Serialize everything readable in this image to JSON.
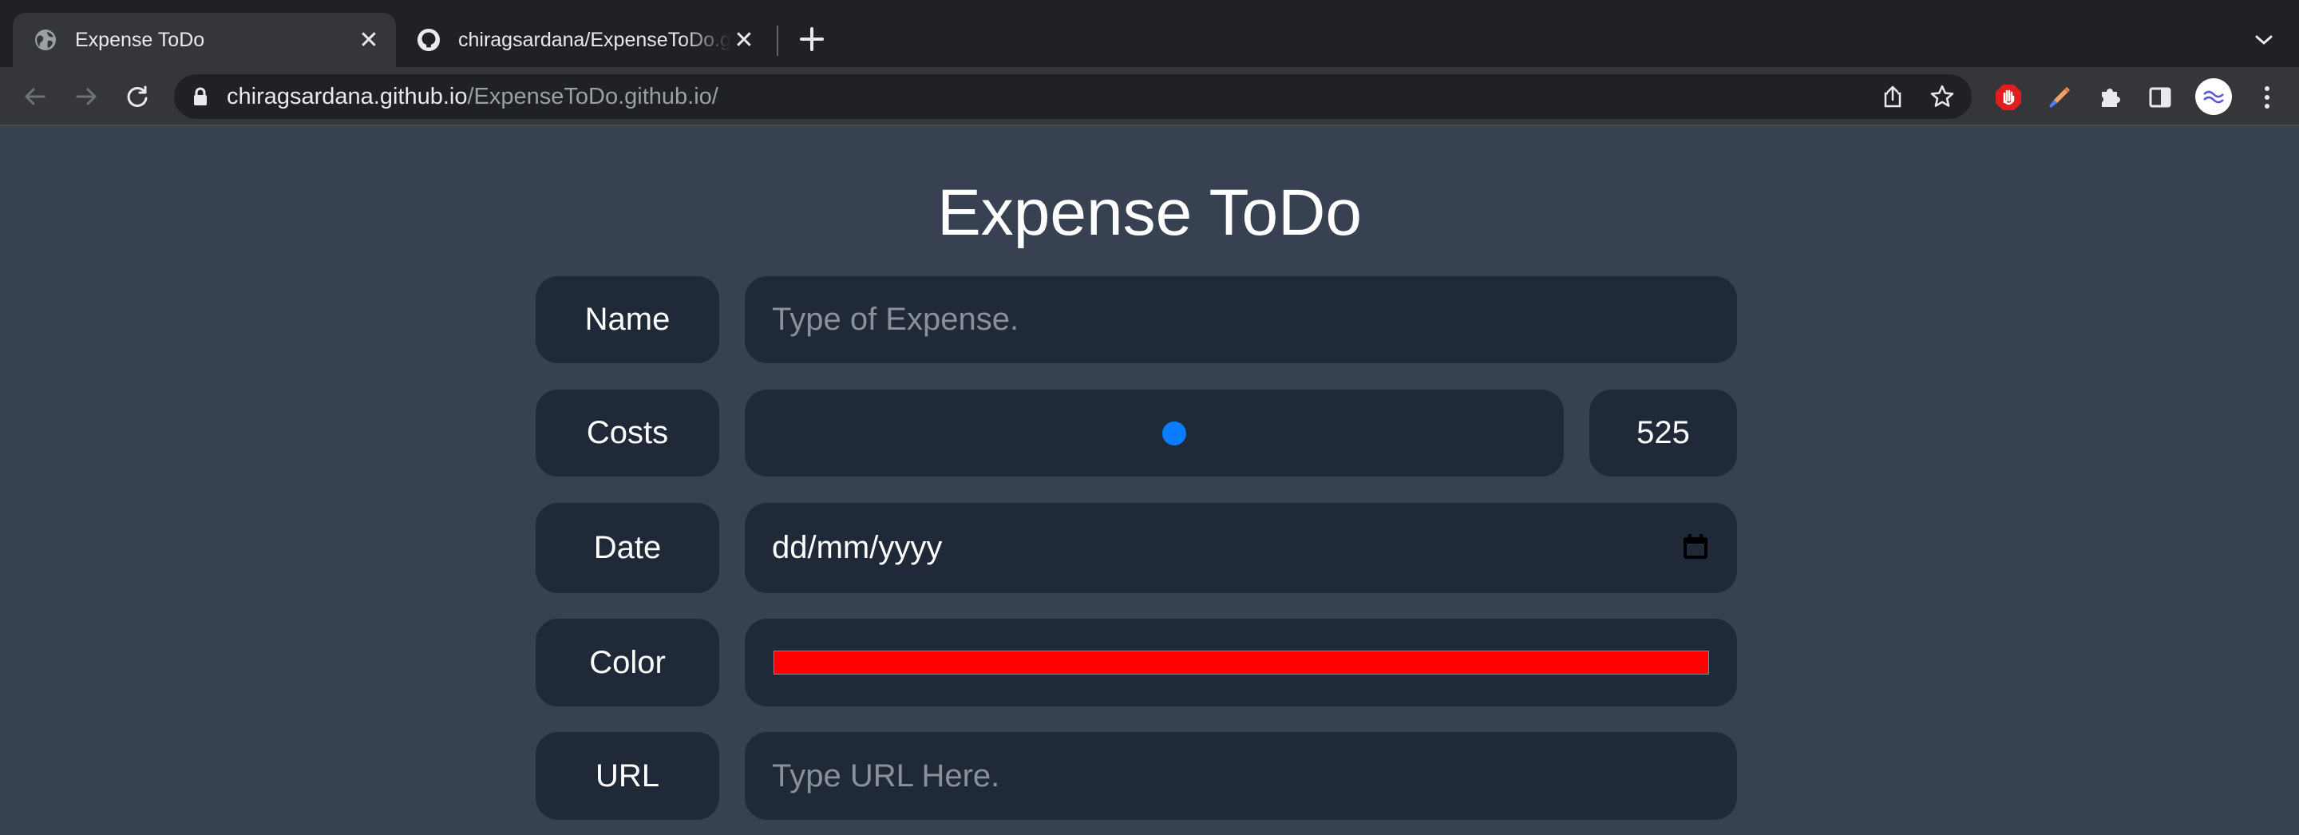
{
  "browser": {
    "tabs": [
      {
        "title": "Expense ToDo",
        "active": true,
        "favicon": "globe-icon"
      },
      {
        "title": "chiragsardana/ExpenseToDo.github.io",
        "active": false,
        "favicon": "github-icon"
      }
    ],
    "address_bar": {
      "host": "chiragsardana.github.io",
      "path": "/ExpenseToDo.github.io/"
    },
    "colors": {
      "tabstrip": "#202124",
      "toolbar": "#35363a",
      "omnibox": "#202124"
    }
  },
  "page": {
    "title": "Expense ToDo",
    "background": "#374151",
    "form": {
      "name": {
        "label": "Name",
        "placeholder": "Type of Expense."
      },
      "costs": {
        "label": "Costs",
        "value": "525",
        "slider_fraction": 0.525,
        "thumb_color": "#0a7cff"
      },
      "date": {
        "label": "Date",
        "placeholder": "dd/mm/yyyy",
        "icon": "calendar-icon"
      },
      "color": {
        "label": "Color",
        "value": "#ff0000"
      },
      "url": {
        "label": "URL",
        "placeholder": "Type URL Here."
      }
    }
  }
}
